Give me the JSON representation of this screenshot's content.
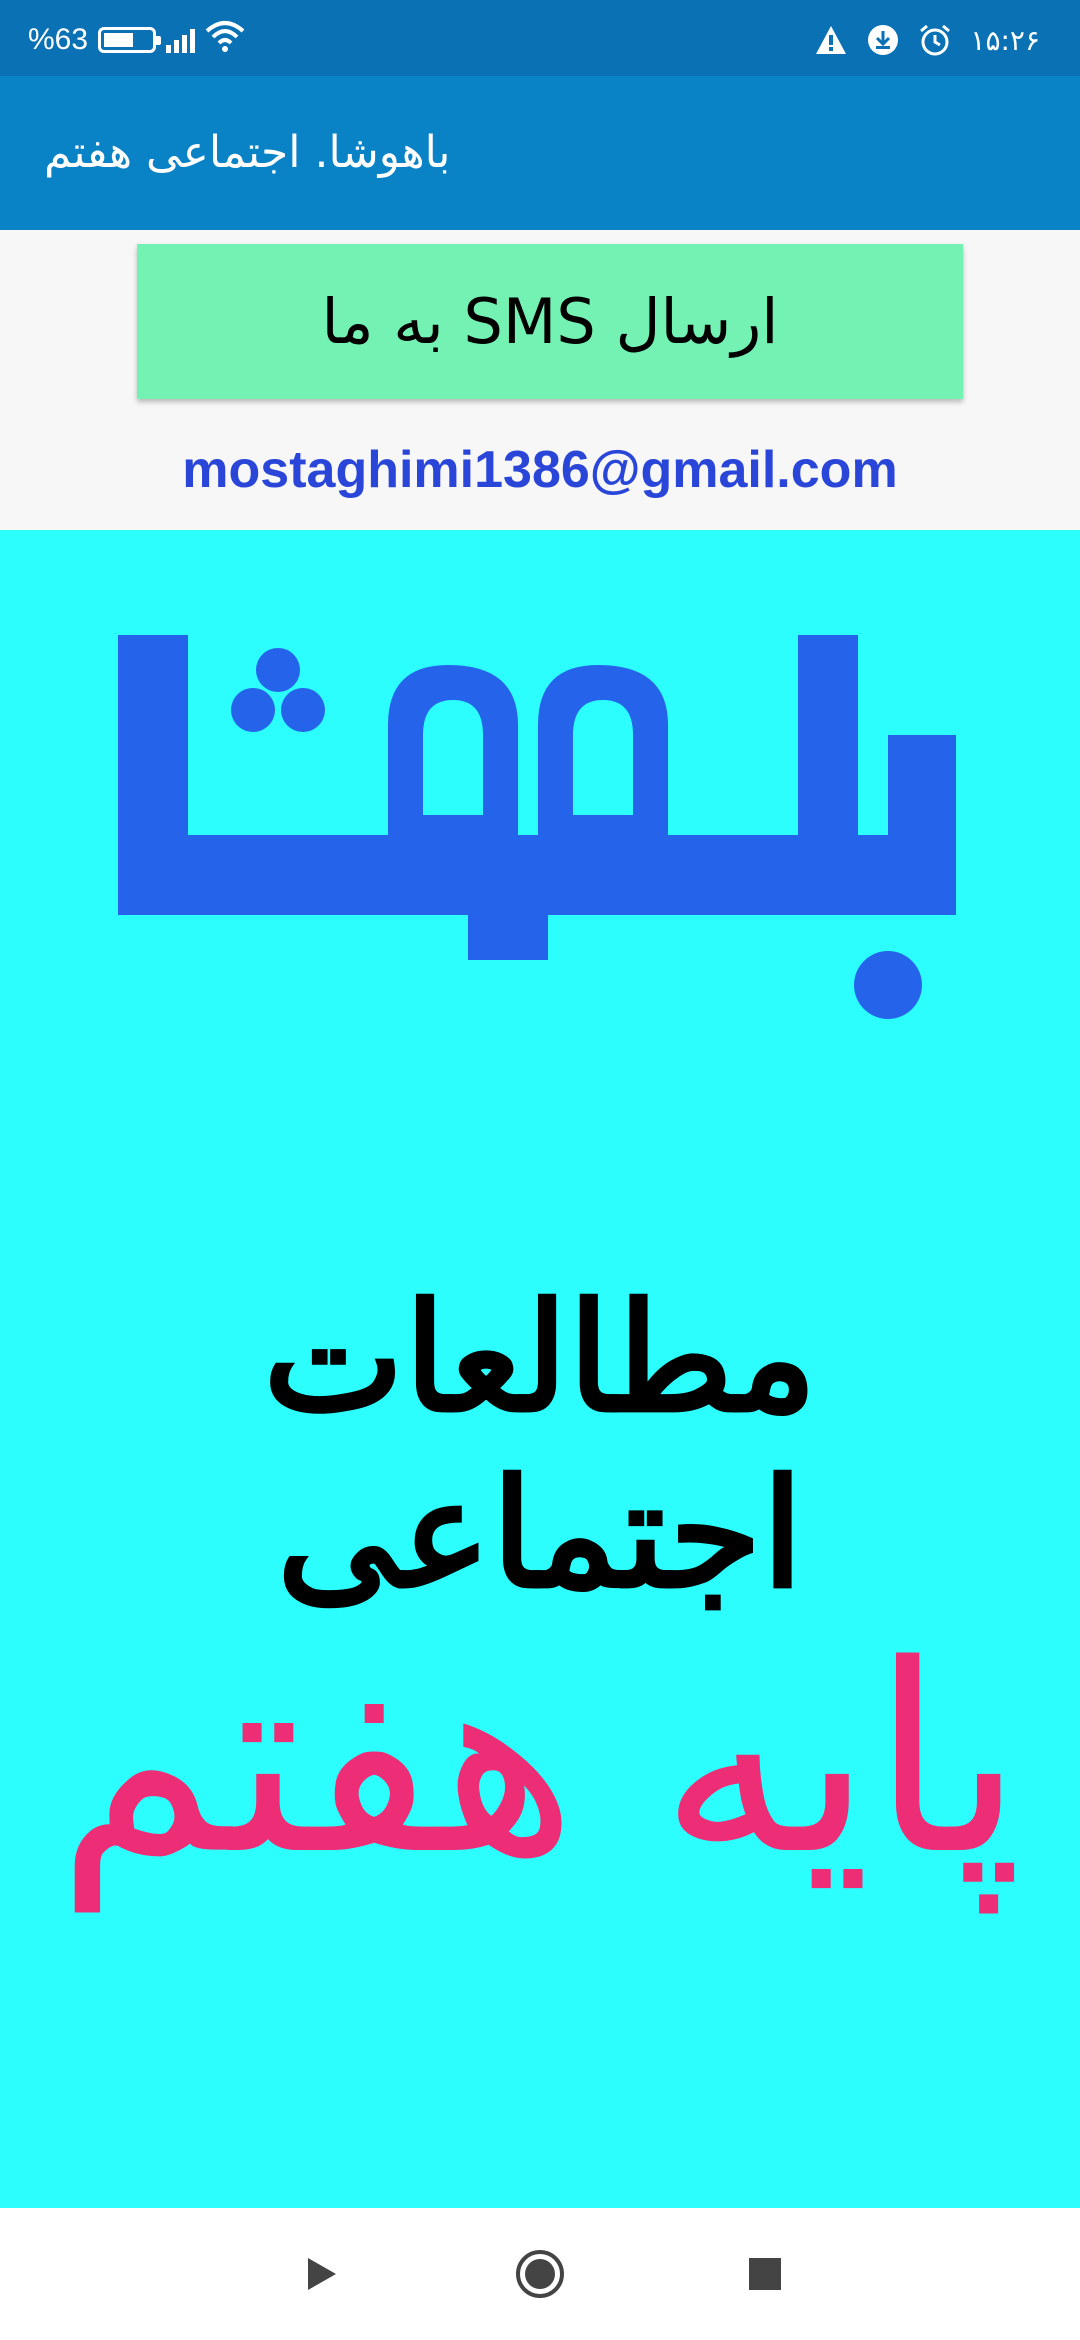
{
  "status_bar": {
    "battery_text": "%63",
    "battery_level": 0.63,
    "time": "۱۵:۲۶",
    "icons": [
      "battery-icon",
      "signal-icon",
      "wifi-icon",
      "warning-icon",
      "download-icon",
      "alarm-icon"
    ]
  },
  "app_bar": {
    "title": "باهوشا. اجتماعی هفتم"
  },
  "content": {
    "sms_button_label": "ارسال SMS به ما",
    "email": "mostaghimi1386@gmail.com"
  },
  "banner": {
    "logo_text": "باهوشا",
    "subject": "مطالعات اجتماعی",
    "grade": "پایه هفتم",
    "background_color": "#2cfefe",
    "logo_color": "#2563eb",
    "grade_color": "#ee2d77"
  },
  "nav_bar": {
    "icons": [
      "back-icon",
      "home-icon",
      "recents-icon"
    ]
  }
}
